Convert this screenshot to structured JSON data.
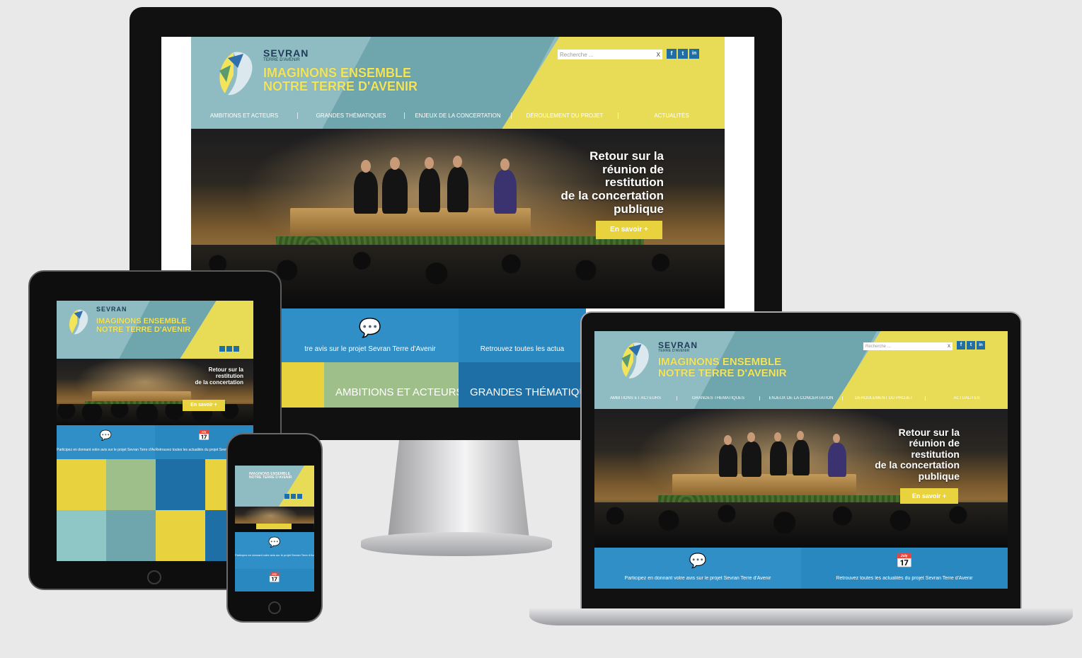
{
  "site": {
    "brand": "SEVRAN",
    "brand_sub": "TERRE D'AVENIR",
    "slogan_line1": "IMAGINONS ENSEMBLE",
    "slogan_line2": "NOTRE TERRE D'AVENIR",
    "search_placeholder": "Recherche ...",
    "search_clear": "X",
    "social": [
      "f",
      "t",
      "in"
    ],
    "nav": [
      "AMBITIONS ET ACTEURS",
      "GRANDES THÉMATIQUES",
      "ENJEUX DE LA CONCERTATION",
      "DÉROULEMENT DU PROJET",
      "ACTUALITÉS"
    ],
    "hero_title_lines": [
      "Retour sur la",
      "réunion de",
      "restitution",
      "de la concertation",
      "publique"
    ],
    "hero_button": "En savoir +",
    "tile_participate": "Participez en donnant votre avis sur le projet Sevran Terre d'Avenir",
    "tile_participate_cropped": "tre avis sur le projet Sevran Terre d'Avenir",
    "tile_news": "Retrouvez toutes les actualités du projet Sevran Terre d'Avenir",
    "tile_news_cropped": "Retrouvez toutes les actua",
    "tile_ambitions": "AMBITIONS ET ACTEURS",
    "tile_themes": "GRANDES THÉMATIQUES"
  },
  "colors": {
    "teal": "#8fbcc2",
    "teal_dark": "#6fa5ad",
    "yellow": "#e8dc57",
    "blue": "#2f8fc6",
    "navy": "#1f3b57",
    "green": "#9fbf8a"
  },
  "icons": [
    "speech-bubble-icon",
    "calendar-icon",
    "facebook-icon",
    "twitter-icon",
    "linkedin-icon",
    "search-clear-icon"
  ]
}
